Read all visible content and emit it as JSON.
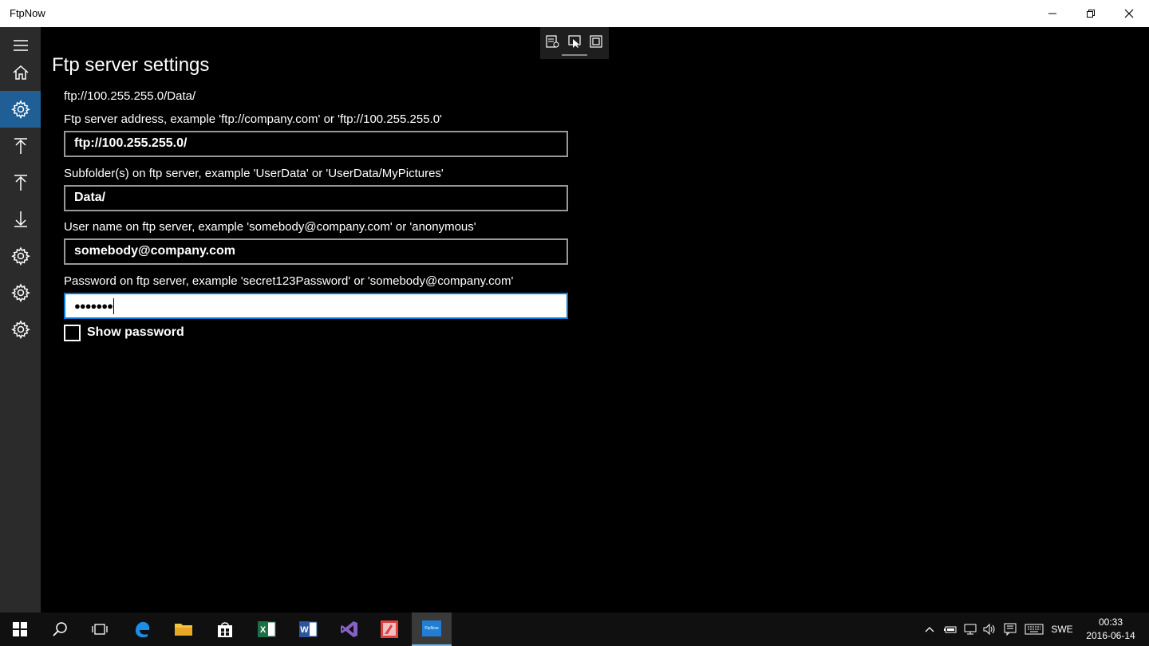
{
  "window": {
    "title": "FtpNow"
  },
  "main": {
    "page_title": "Ftp server settings",
    "current_url": "ftp://100.255.255.0/Data/",
    "fields": [
      {
        "label": "Ftp server address, example 'ftp://company.com' or 'ftp://100.255.255.0'",
        "value": "ftp://100.255.255.0/"
      },
      {
        "label": "Subfolder(s) on ftp server, example 'UserData' or 'UserData/MyPictures'",
        "value": "Data/"
      },
      {
        "label": "User name on ftp server, example 'somebody@company.com' or 'anonymous'",
        "value": "somebody@company.com"
      },
      {
        "label": "Password on ftp server, example 'secret123Password' or 'somebody@company.com'",
        "value": "●●●●●●●"
      }
    ],
    "show_password_label": "Show password"
  },
  "taskbar": {
    "language": "SWE",
    "time": "00:33",
    "date": "2016-06-14",
    "active_app_label": "FtpNow"
  },
  "colors": {
    "accent": "#1f5f96",
    "focus_border": "#0078d7"
  }
}
